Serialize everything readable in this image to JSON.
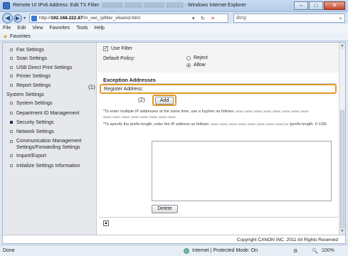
{
  "window": {
    "title": "Remote UI IPv6 Address: Edit TX Filter: ░░░░░░ ░░░░░ ░░░░░░ ░░░░░ - Windows Internet Explorer",
    "minimize": "–",
    "maximize": "□",
    "close": "✕"
  },
  "navbar": {
    "back": "◀",
    "forward": "▶",
    "url_prefix": "http://",
    "url_host": "192.168.222.87",
    "url_path": "/m_sec_ipfilter_v6send.html",
    "search_placeholder": "Bing",
    "search_icon": "⌕",
    "refresh_icon": "↻",
    "stop_icon": "✕",
    "dropdown_icon": "▾"
  },
  "menubar": [
    "File",
    "Edit",
    "View",
    "Favorites",
    "Tools",
    "Help"
  ],
  "favorites": {
    "label": "Favorites"
  },
  "sidebar": {
    "items": [
      {
        "label": "Fax Settings",
        "type": "item"
      },
      {
        "label": "Scan Settings",
        "type": "item"
      },
      {
        "label": "USB Direct Print Settings",
        "type": "item"
      },
      {
        "label": "Printer Settings",
        "type": "item"
      },
      {
        "label": "Report Settings",
        "type": "item"
      },
      {
        "label": "System Settings",
        "type": "head"
      },
      {
        "label": "System Settings",
        "type": "item"
      },
      {
        "label": "Department ID Management",
        "type": "item"
      },
      {
        "label": "Security Settings",
        "type": "active"
      },
      {
        "label": "Network Settings",
        "type": "item"
      },
      {
        "label": "Communication Management Settings/Forwarding Settings",
        "type": "two"
      },
      {
        "label": "Import/Export",
        "type": "item"
      },
      {
        "label": "Initialize Settings Information",
        "type": "item"
      }
    ]
  },
  "main": {
    "use_filter_label": "Use Filter",
    "use_filter_checked": "✓",
    "default_policy_label": "Default Policy:",
    "reject_label": "Reject",
    "allow_label": "Allow",
    "exception_title": "Exception Addresses",
    "register_label": "Register Address:",
    "register_value": "",
    "callout_1": "(1)",
    "callout_2": "(2)",
    "add_label": "Add",
    "note1": "*To enter multiple IP addresses at the same time, use a hyphen as follows:",
    "note1_mono": "xxxx:xxxx:xxxx:xxxx:xxxx:xxxx:xxxx:xxxx-",
    "note1_line2_mono": "xxxx:xxxx:xxxx:xxxx:xxxx:xxxx:xxxx:xxxx",
    "note2": "*To specify the prefix length, enter the IP address as follows:",
    "note2_mono": "xxxx:xxxx:xxxx:xxxx:xxxx:xxxx:xxxx:xxxx/xx",
    "note2_tail": "(prefix length: 0-128)",
    "delete_label": "Delete",
    "top_icon": "▲",
    "copyright": "Copyright CANON INC. 2011 All Rights Reserved"
  },
  "statusbar": {
    "done": "Done",
    "zone": "Internet | Protected Mode: On",
    "zoom": "100%",
    "zoom_icon": "🔍",
    "security_icon": "⚙"
  }
}
